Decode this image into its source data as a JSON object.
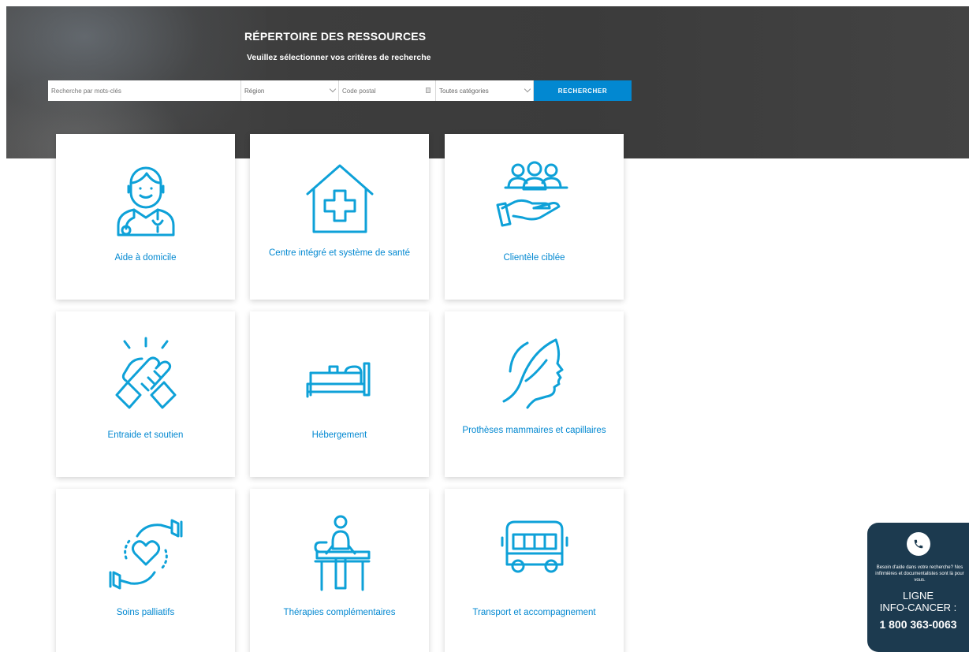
{
  "header": {
    "title": "RÉPERTOIRE DES RESSOURCES",
    "subtitle": "Veuillez sélectionner vos critères de recherche"
  },
  "search": {
    "keyword_placeholder": "Recherche par mots-clés",
    "region_value": "Région",
    "postal_placeholder": "Code postal",
    "category_value": "Toutes catégories",
    "button_label": "RECHERCHER"
  },
  "categories": [
    {
      "label": "Aide à domicile",
      "icon": "home-care-nurse-icon"
    },
    {
      "label": "Centre intégré et système de santé",
      "icon": "health-center-house-icon"
    },
    {
      "label": "Clientèle ciblée",
      "icon": "target-clients-icon"
    },
    {
      "label": "Entraide et soutien",
      "icon": "helping-hands-icon"
    },
    {
      "label": "Hébergement",
      "icon": "bed-icon"
    },
    {
      "label": "Prothèses mammaires et capillaires",
      "icon": "face-profile-icon"
    },
    {
      "label": "Soins palliatifs",
      "icon": "hands-heart-icon"
    },
    {
      "label": "Thérapies complémentaires",
      "icon": "massage-therapy-icon"
    },
    {
      "label": "Transport et accompagnement",
      "icon": "bus-icon"
    }
  ],
  "help": {
    "message": "Besoin d'aide dans votre recherche? Nos infirmières et documentalistes sont là pour vous.",
    "line1": "LIGNE",
    "line2": "INFO-CANCER :",
    "phone": "1 800 363-0063"
  },
  "colors": {
    "accent": "#0288d1",
    "icon": "#0ea1d8",
    "help_bg": "#1c3a4f"
  }
}
